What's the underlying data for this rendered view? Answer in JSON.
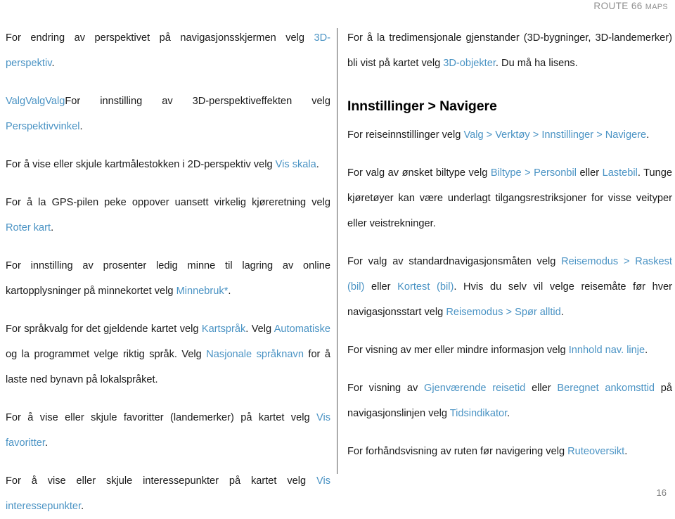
{
  "header": {
    "title_main": "ROUTE 66 ",
    "title_small": "MAPS"
  },
  "footer": {
    "page_number": "16"
  },
  "left_column": {
    "paragraphs": [
      {
        "id": "p-3d-perspektiv",
        "runs": [
          {
            "text": "For endring av perspektivet på navigasjonsskjermen velg ",
            "link": false
          },
          {
            "text": "3D-perspektiv",
            "link": true
          },
          {
            "text": ".",
            "link": false
          }
        ]
      },
      {
        "id": "p-perspektivvinkel",
        "runs": [
          {
            "text": "ValgValgValg",
            "link": true
          },
          {
            "text": "For innstilling av 3D-perspektiveffekten velg ",
            "link": false
          },
          {
            "text": "Perspektivvinkel",
            "link": true
          },
          {
            "text": ".",
            "link": false
          }
        ]
      },
      {
        "id": "p-vis-skala",
        "runs": [
          {
            "text": "For å vise eller skjule kartmålestokken i 2D-perspektiv velg ",
            "link": false
          },
          {
            "text": "Vis skala",
            "link": true
          },
          {
            "text": ".",
            "link": false
          }
        ]
      },
      {
        "id": "p-roter-kart",
        "runs": [
          {
            "text": "For å la GPS-pilen peke oppover uansett virkelig kjøreretning velg ",
            "link": false
          },
          {
            "text": "Roter kart",
            "link": true
          },
          {
            "text": ".",
            "link": false
          }
        ]
      },
      {
        "id": "p-minnebruk",
        "runs": [
          {
            "text": "For innstilling av prosenter ledig minne til lagring av online kartopplysninger på minnekortet velg ",
            "link": false
          },
          {
            "text": "Minnebruk*",
            "link": true
          },
          {
            "text": ".",
            "link": false
          }
        ]
      },
      {
        "id": "p-kartsprak",
        "runs": [
          {
            "text": "For språkvalg for det gjeldende kartet velg ",
            "link": false
          },
          {
            "text": "Kartspråk",
            "link": true
          },
          {
            "text": ". Velg ",
            "link": false
          },
          {
            "text": "Automatiske",
            "link": true
          },
          {
            "text": " og la programmet velge riktig språk. Velg ",
            "link": false
          },
          {
            "text": "Nasjonale språknavn",
            "link": true
          },
          {
            "text": " for å laste ned bynavn på lokalspråket.",
            "link": false
          }
        ]
      },
      {
        "id": "p-vis-favoritter",
        "runs": [
          {
            "text": "For å vise eller skjule favoritter (landemerker) på kartet velg ",
            "link": false
          },
          {
            "text": "Vis favoritter",
            "link": true
          },
          {
            "text": ".",
            "link": false
          }
        ]
      },
      {
        "id": "p-vis-interessepunkter",
        "runs": [
          {
            "text": "For å vise eller skjule interessepunkter på kartet velg ",
            "link": false
          },
          {
            "text": "Vis interessepunkter",
            "link": true
          },
          {
            "text": ".",
            "link": false
          }
        ]
      }
    ]
  },
  "right_column": {
    "blocks": [
      {
        "type": "paragraph",
        "id": "p-3d-objekter",
        "runs": [
          {
            "text": "For å la tredimensjonale gjenstander (3D-bygninger, 3D-landemerker) bli vist på kartet velg ",
            "link": false
          },
          {
            "text": "3D-objekter",
            "link": true
          },
          {
            "text": ". Du må ha lisens.",
            "link": false
          }
        ]
      },
      {
        "type": "heading",
        "id": "h-innstillinger-navigere",
        "text": "Innstillinger > Navigere"
      },
      {
        "type": "paragraph",
        "id": "p-reiseinnstillinger",
        "runs": [
          {
            "text": "For reiseinnstillinger velg ",
            "link": false
          },
          {
            "text": "Valg > Verktøy > Innstillinger > Navigere",
            "link": true
          },
          {
            "text": ".",
            "link": false
          }
        ]
      },
      {
        "type": "paragraph",
        "id": "p-biltype",
        "runs": [
          {
            "text": "For valg av ønsket biltype velg ",
            "link": false
          },
          {
            "text": "Biltype > Personbil",
            "link": true
          },
          {
            "text": " eller ",
            "link": false
          },
          {
            "text": "Lastebil",
            "link": true
          },
          {
            "text": ". Tunge kjøretøyer kan være underlagt tilgangsrestriksjoner for visse veityper eller veistrekninger.",
            "link": false
          }
        ]
      },
      {
        "type": "paragraph",
        "id": "p-reisemodus",
        "runs": [
          {
            "text": "For valg av standardnavigasjonsmåten velg ",
            "link": false
          },
          {
            "text": "Reisemodus > Raskest (bil)",
            "link": true
          },
          {
            "text": " eller ",
            "link": false
          },
          {
            "text": "Kortest (bil)",
            "link": true
          },
          {
            "text": ". Hvis du selv vil velge reisemåte før hver navigasjonsstart velg ",
            "link": false
          },
          {
            "text": "Reisemodus > Spør alltid",
            "link": true
          },
          {
            "text": ".",
            "link": false
          }
        ]
      },
      {
        "type": "paragraph",
        "id": "p-innhold-nav-linje",
        "runs": [
          {
            "text": "For visning av mer eller mindre informasjon velg ",
            "link": false
          },
          {
            "text": "Innhold nav. linje",
            "link": true
          },
          {
            "text": ".",
            "link": false
          }
        ]
      },
      {
        "type": "paragraph",
        "id": "p-tidsindikator",
        "runs": [
          {
            "text": "For visning av ",
            "link": false
          },
          {
            "text": "Gjenværende reisetid",
            "link": true
          },
          {
            "text": " eller ",
            "link": false
          },
          {
            "text": "Beregnet ankomsttid",
            "link": true
          },
          {
            "text": " på navigasjonslinjen velg ",
            "link": false
          },
          {
            "text": "Tidsindikator",
            "link": true
          },
          {
            "text": ".",
            "link": false
          }
        ]
      },
      {
        "type": "paragraph",
        "id": "p-ruteoversikt",
        "runs": [
          {
            "text": "For forhåndsvisning av ruten før navigering velg ",
            "link": false
          },
          {
            "text": "Ruteoversikt",
            "link": true
          },
          {
            "text": ".",
            "link": false
          }
        ]
      }
    ]
  },
  "colors": {
    "link": "#4a93c4",
    "text": "#1a1a1a",
    "header_gray": "#8e8e8e",
    "divider": "#585858"
  }
}
